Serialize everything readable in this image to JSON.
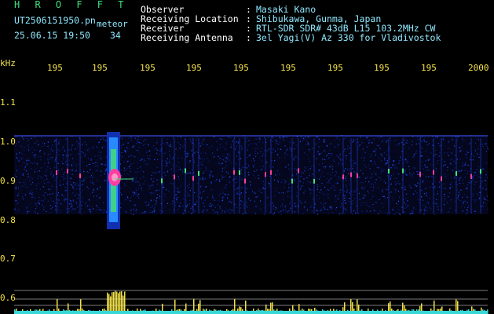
{
  "header": {
    "program": "H R O F F T",
    "filename": "UT2506151950.pn",
    "detection": "meteor",
    "timestamp": "25.06.15 19:50",
    "count": "34"
  },
  "info": [
    {
      "label": "Observer",
      "value": "Masaki Kano"
    },
    {
      "label": "Receiving Location",
      "value": "Shibukawa, Gunma, Japan"
    },
    {
      "label": "Receiver",
      "value": "RTL-SDR SDR# 43dB L15 103.2MHz CW"
    },
    {
      "label": "Receiving Antenna",
      "value": "3el Yagi(V) Az 330 for Vladivostok"
    }
  ],
  "axis": {
    "y_unit": "kHz",
    "y_ticks": [
      "1.1",
      "1.0",
      "0.9",
      "0.8",
      "0.7",
      "0.6"
    ],
    "x_ticks": [
      "195",
      "195",
      "195",
      "195",
      "195",
      "195",
      "195",
      "195",
      "195",
      "2000"
    ]
  },
  "colors": {
    "cyan": "#8fe8ff",
    "green": "#3fe07a",
    "yellow": "#f2e24a",
    "white": "#ffffff"
  }
}
